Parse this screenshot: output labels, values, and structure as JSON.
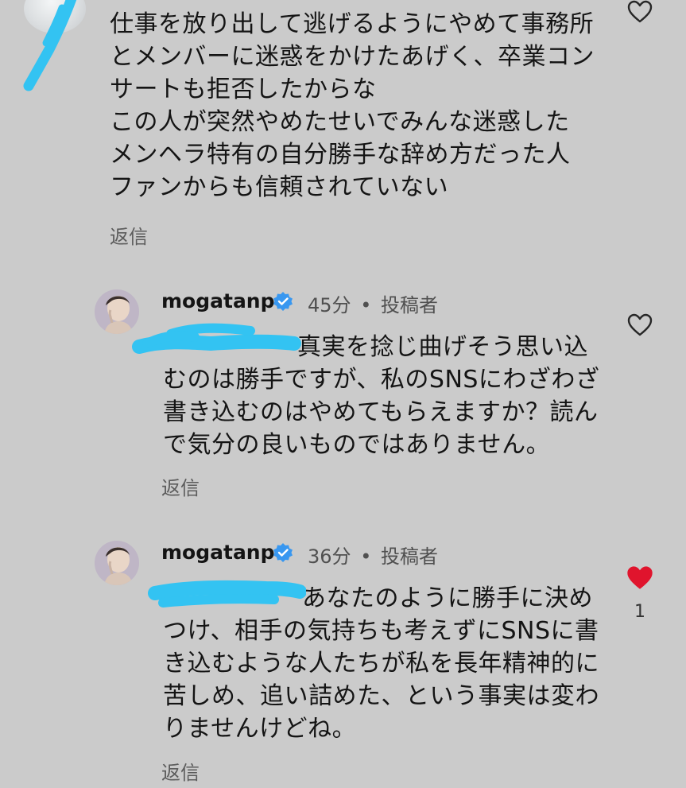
{
  "comments": {
    "top": {
      "text": "仕事を放り出して逃げるようにやめて事務所\nとメンバーに迷惑をかけたあげく、卒業コン\nサートも拒否したからな\nこの人が突然やめたせいでみんな迷惑した\nメンヘラ特有の自分勝手な辞め方だった人\nファンからも信頼されていない",
      "reply_label": "返信",
      "liked": false
    },
    "replies": [
      {
        "username": "mogatanpe",
        "verified": true,
        "time": "45分",
        "separator": "•",
        "role": "投稿者",
        "text": "真実を捻じ曲げそう思い込\nむのは勝手ですが、私のSNSにわざわざ\n書き込むのはやめてもらえますか？読ん\nで気分の良いものではありません。",
        "reply_label": "返信",
        "liked": false,
        "like_count": ""
      },
      {
        "username": "mogatanpe",
        "verified": true,
        "time": "36分",
        "separator": "•",
        "role": "投稿者",
        "text": "あなたのように勝手に決め\nつけ、相手の気持ちも考えずにSNSに書\nき込むような人たちが私を長年精神的に\n苦しめ、追い詰めた、という事実は変わ\nりませんけどね。",
        "reply_label": "返信",
        "liked": true,
        "like_count": "1"
      }
    ]
  },
  "colors": {
    "background": "#cbcbcb",
    "verified": "#3897f0",
    "liked_heart": "#e0142d",
    "redaction": "#33c3f2"
  },
  "icons": {
    "like": "heart-outline-icon",
    "liked": "heart-filled-icon",
    "verified": "verified-badge-icon"
  }
}
